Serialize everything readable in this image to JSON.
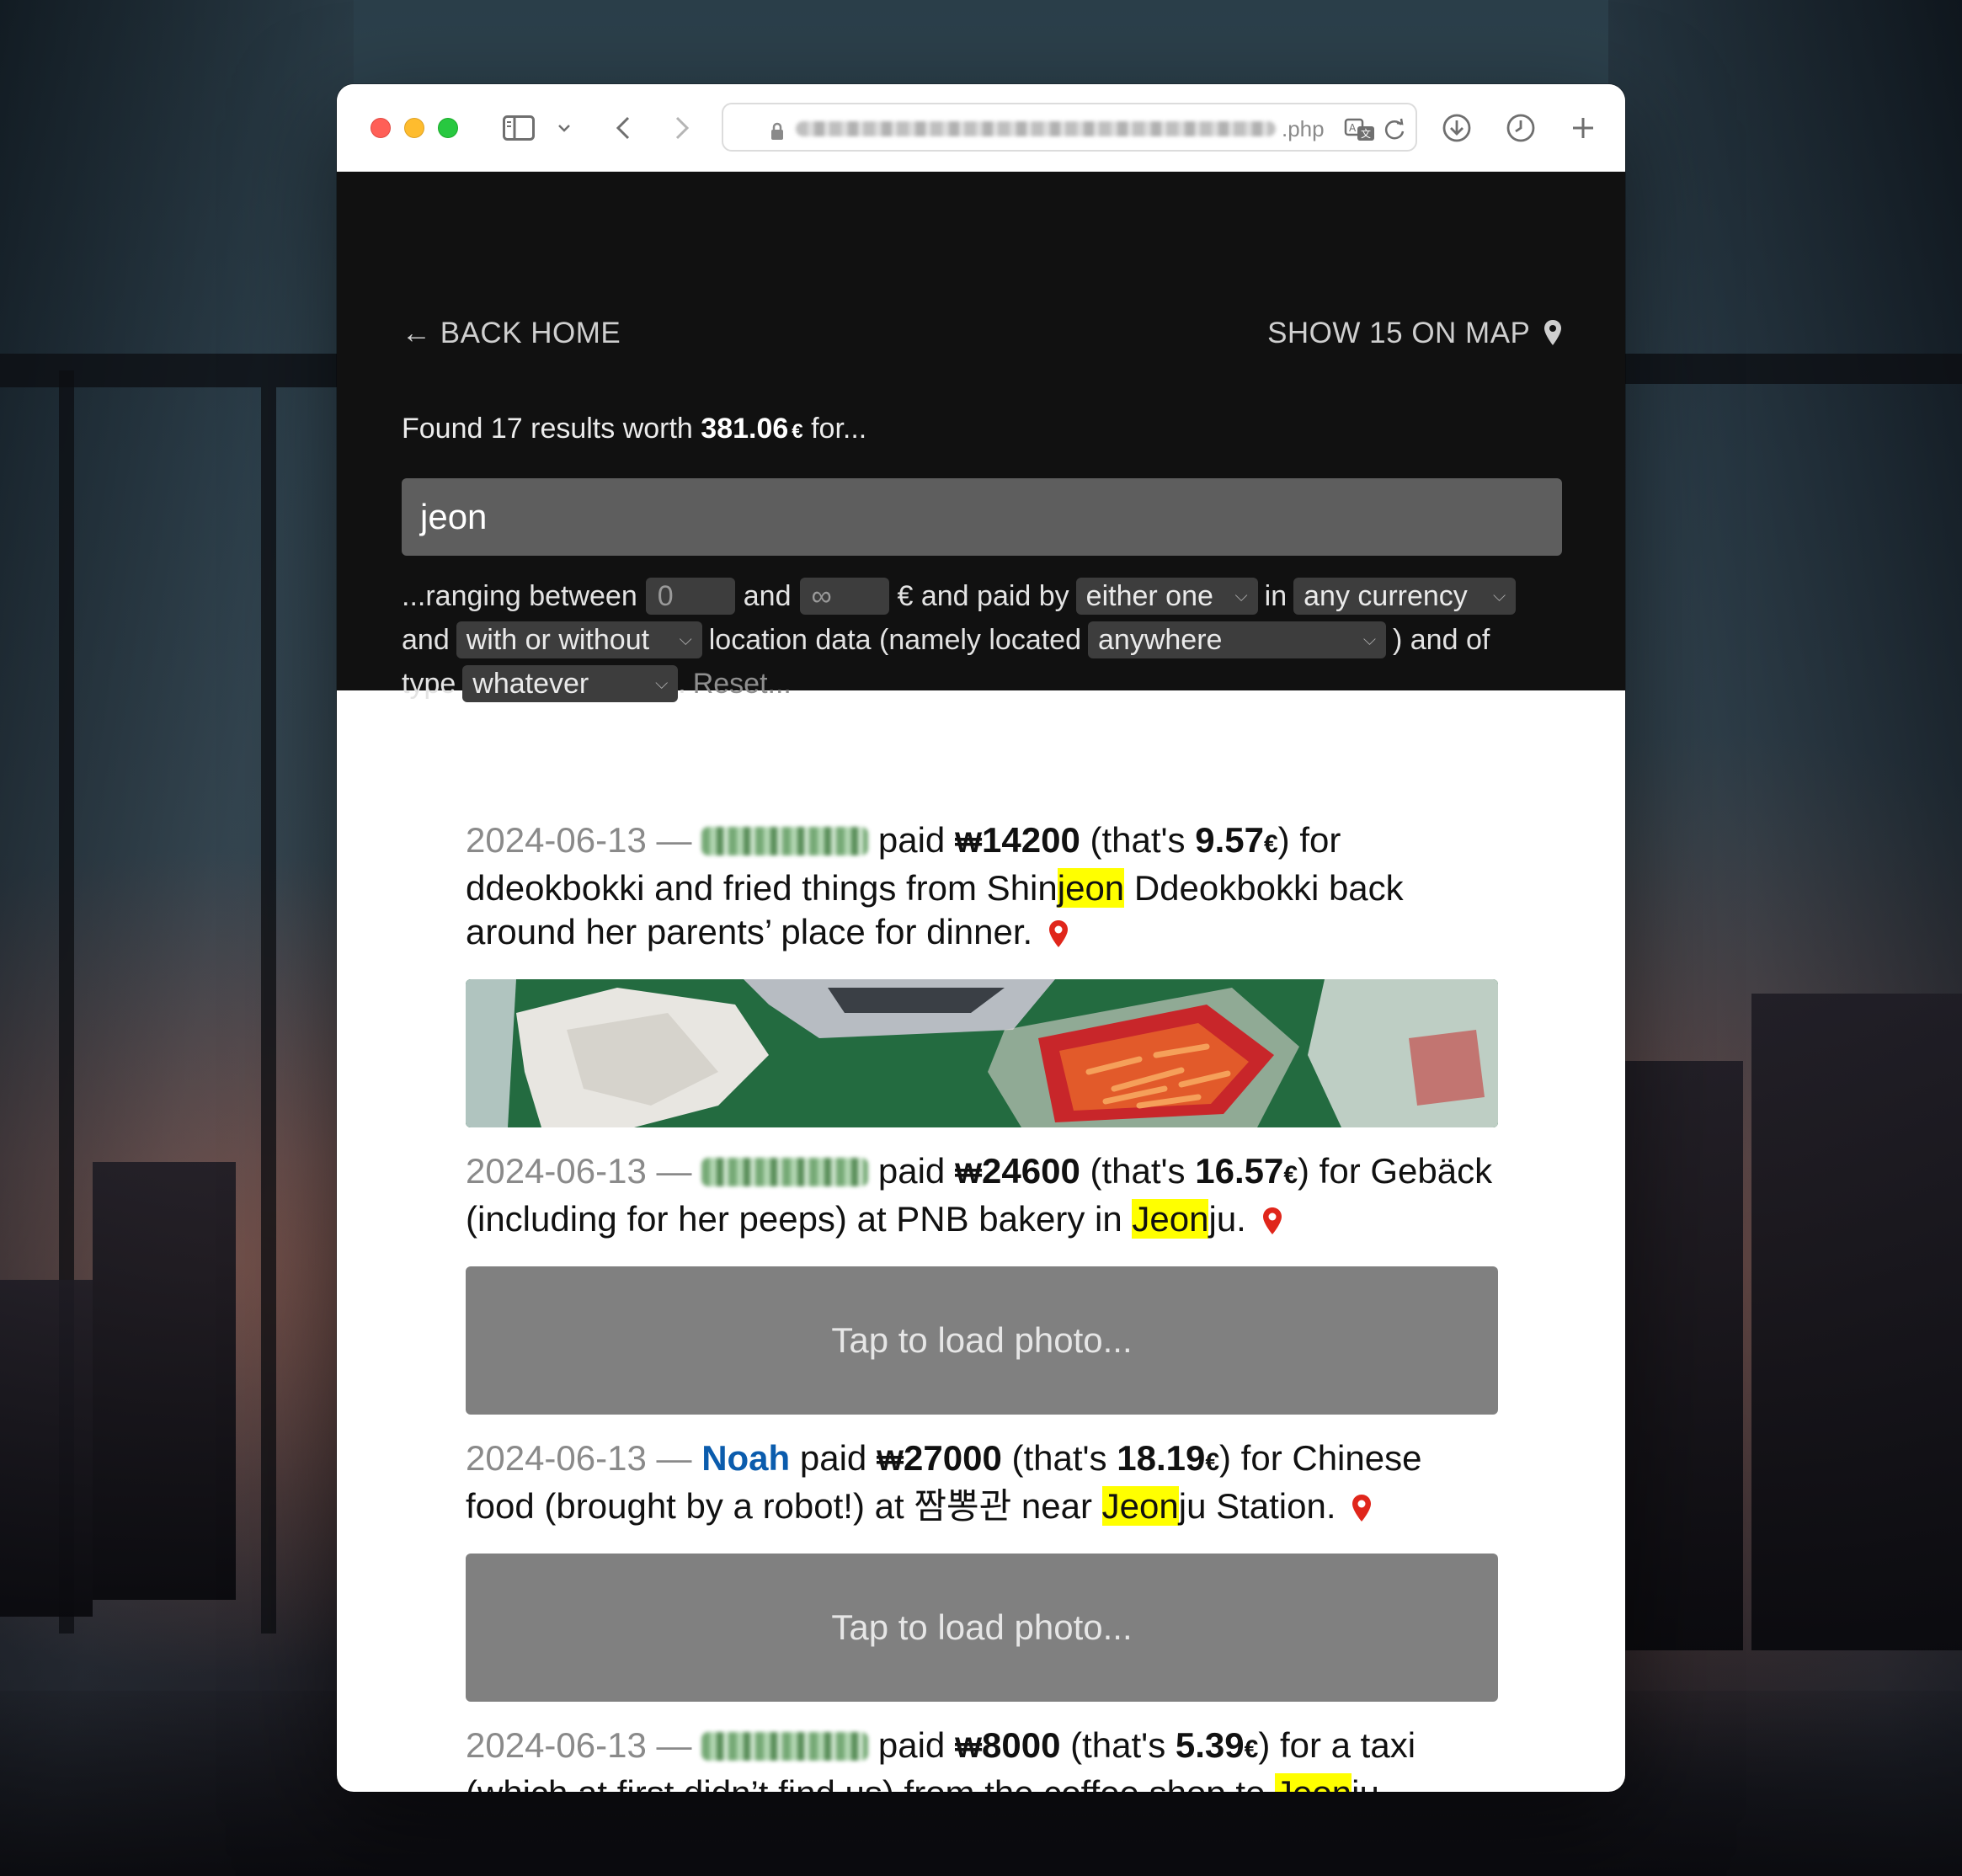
{
  "browser": {
    "url_suffix": ".php"
  },
  "header": {
    "back_label": "← BACK HOME",
    "map_label": "SHOW 15 ON MAP",
    "found_prefix": "Found 17 results worth ",
    "found_total": "381.06",
    "found_currency": "€",
    "found_suffix": " for...",
    "search_value": "jeon"
  },
  "filters": {
    "t_ranging": "...ranging between",
    "min_value": "0",
    "t_and1": "and",
    "max_value": "∞",
    "t_paid_by": "€ and paid by",
    "payer_select": "either one",
    "t_in": "in",
    "currency_select": "any currency",
    "t_and2": "and",
    "location_data_select": "with or without",
    "t_location_data": "location data (namely located",
    "location_select": "anywhere",
    "t_and_of": ") and of",
    "t_type": "type",
    "type_select": "whatever",
    "t_period": ".",
    "reset_label": "Reset..."
  },
  "results": [
    {
      "date": "2024-06-13 —",
      "payer": "",
      "paid": "paid",
      "currency_symbol": "₩",
      "amount": "14200",
      "thats": "(that's",
      "eur_amount": "9.57",
      "eur_symbol": "€",
      "for": ") for",
      "desc_before": "ddeokbokki and fried things from Shin",
      "desc_highlight": "jeon",
      "desc_after": " Ddeokbokki back around her parents’ place for dinner."
    },
    {
      "date": "2024-06-13 —",
      "payer": "",
      "paid": "paid",
      "currency_symbol": "₩",
      "amount": "24600",
      "thats": "(that's",
      "eur_amount": "16.57",
      "eur_symbol": "€",
      "for": ") for",
      "desc_before": "Gebäck (including for her peeps) at PNB bakery in ",
      "desc_highlight": "Jeon",
      "desc_after": "ju.",
      "photo_placeholder": "Tap to load photo..."
    },
    {
      "date": "2024-06-13 —",
      "payer": "Noah",
      "paid": "paid",
      "currency_symbol": "₩",
      "amount": "27000",
      "thats": "(that's",
      "eur_amount": "18.19",
      "eur_symbol": "€",
      "for": ") for Chinese",
      "desc_before": "food (brought by a robot!) at 짬뽕관 near ",
      "desc_highlight": "Jeon",
      "desc_after": "ju Station.",
      "photo_placeholder": "Tap to load photo..."
    },
    {
      "date": "2024-06-13 —",
      "payer": "",
      "paid": "paid",
      "currency_symbol": "₩",
      "amount": "8000",
      "thats": "(that's",
      "eur_amount": "5.39",
      "eur_symbol": "€",
      "for": ") for a taxi",
      "desc_before": "(which at first didn’t find us) from the coffee shop to ",
      "desc_highlight": "Jeon",
      "desc_after": "ju"
    }
  ],
  "colors": {
    "highlight": "#ffff00",
    "pin": "#e0261b",
    "payer_link": "#0b5cad",
    "header_bg": "#111111"
  },
  "icons": [
    "sidebar-icon",
    "chevron-down-icon",
    "back-icon",
    "forward-icon",
    "lock-icon",
    "translate-icon",
    "reload-icon",
    "download-icon",
    "history-icon",
    "new-tab-icon",
    "map-pin-icon"
  ]
}
